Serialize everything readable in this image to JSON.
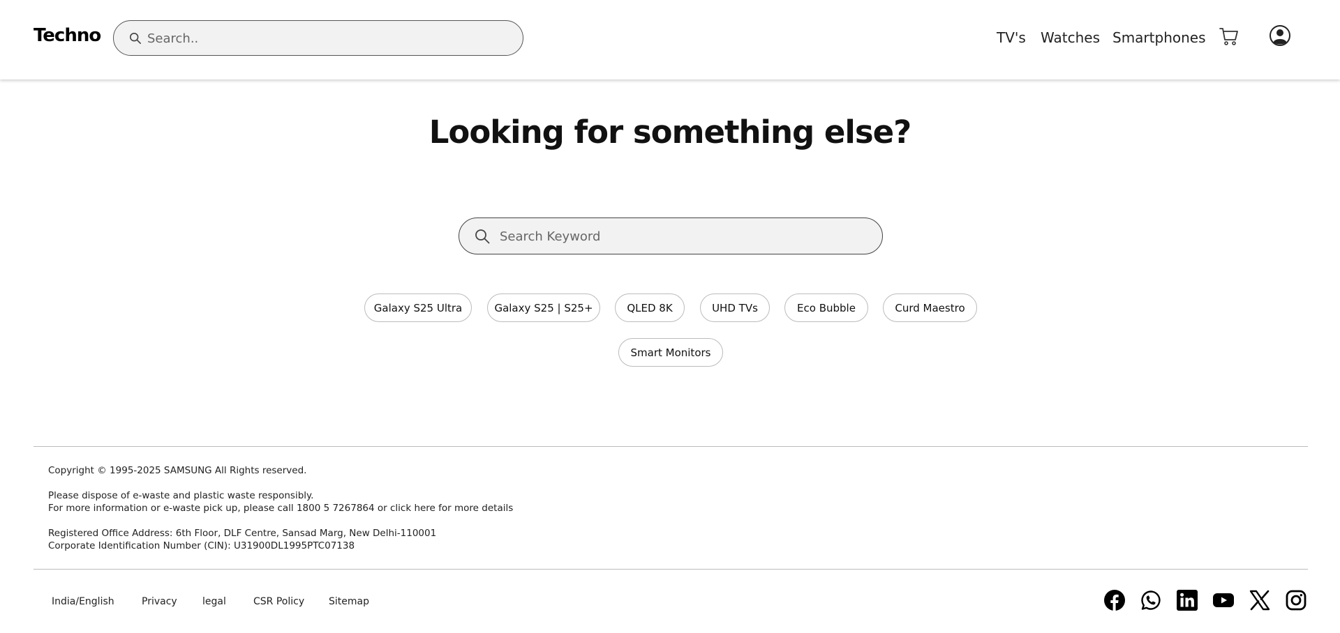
{
  "header": {
    "logo": "Techno",
    "search_placeholder": "Search..",
    "nav": [
      "TV's",
      "Watches",
      "Smartphones"
    ],
    "icons": [
      "search-icon",
      "cart-icon",
      "user-account-icon"
    ]
  },
  "main": {
    "headline": "Looking for something else?",
    "search_placeholder": "Search Keyword",
    "suggestions": [
      "Galaxy S25 Ultra",
      "Galaxy S25 | S25+",
      "QLED 8K",
      "UHD TVs",
      "Eco Bubble",
      "Curd Maestro",
      "Smart Monitors"
    ]
  },
  "footer": {
    "copyright": "Copyright © 1995-2025 SAMSUNG All Rights reserved.",
    "ewaste_line1": "Please dispose of e-waste and plastic waste responsibly.",
    "ewaste_line2": "For more information or e-waste pick up, please call 1800 5 7267864 or click here for more details",
    "address": "Registered Office Address: 6th Floor, DLF Centre, Sansad Marg, New Delhi-110001",
    "cin": "Corporate Identification Number (CIN): U31900DL1995PTC07138",
    "links": [
      "India/English",
      "Privacy",
      "legal",
      "CSR Policy",
      "Sitemap"
    ],
    "social_icons": [
      "facebook-icon",
      "whatsapp-icon",
      "linkedin-icon",
      "youtube-icon",
      "x-icon",
      "instagram-icon"
    ]
  }
}
